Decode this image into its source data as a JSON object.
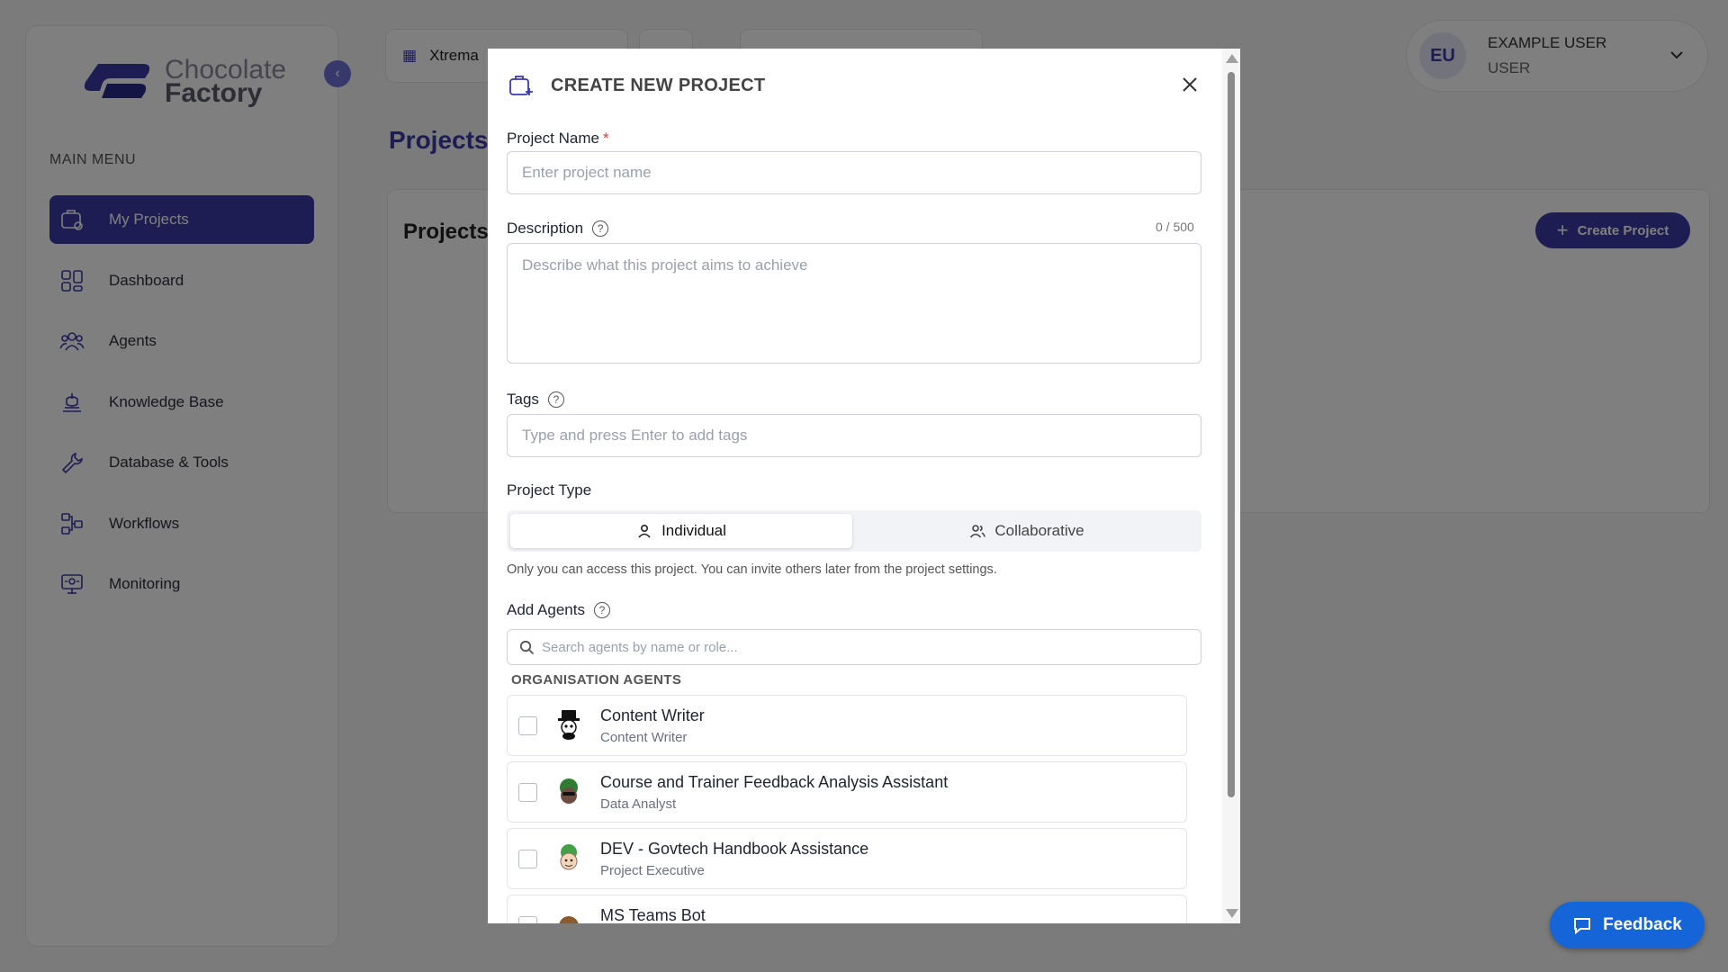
{
  "brand": {
    "line1": "Chocolate",
    "line2": "Factory"
  },
  "sidebar": {
    "heading": "MAIN MENU",
    "items": [
      {
        "label": "My Projects",
        "icon": "projects-icon",
        "active": true
      },
      {
        "label": "Dashboard",
        "icon": "dashboard-icon",
        "active": false
      },
      {
        "label": "Agents",
        "icon": "agents-icon",
        "active": false
      },
      {
        "label": "Knowledge Base",
        "icon": "knowledge-base-icon",
        "active": false
      },
      {
        "label": "Database & Tools",
        "icon": "tools-icon",
        "active": false
      },
      {
        "label": "Workflows",
        "icon": "workflows-icon",
        "active": false
      },
      {
        "label": "Monitoring",
        "icon": "monitoring-icon",
        "active": false
      }
    ]
  },
  "topbar": {
    "org_label": "Xtrema",
    "user": {
      "initials": "EU",
      "name": "EXAMPLE USER",
      "role": "USER"
    }
  },
  "page": {
    "title": "Projects",
    "content_title": "Projects",
    "create_label": "Create Project"
  },
  "modal": {
    "title": "CREATE NEW PROJECT",
    "project_name": {
      "label": "Project Name",
      "required_mark": "*",
      "placeholder": "Enter project name",
      "value": ""
    },
    "description": {
      "label": "Description",
      "counter": "0 / 500",
      "placeholder": "Describe what this project aims to achieve",
      "value": ""
    },
    "tags": {
      "label": "Tags",
      "placeholder": "Type and press Enter to add tags",
      "value": ""
    },
    "project_type": {
      "label": "Project Type",
      "options": [
        "Individual",
        "Collaborative"
      ],
      "selected": "Individual",
      "hint": "Only you can access this project. You can invite others later from the project settings."
    },
    "add_agents": {
      "label": "Add Agents",
      "search_placeholder": "Search agents by name or role...",
      "section_label": "ORGANISATION AGENTS",
      "agents": [
        {
          "name": "Content Writer",
          "role": "Content Writer",
          "checked": false
        },
        {
          "name": "Course and Trainer Feedback Analysis Assistant",
          "role": "Data Analyst",
          "checked": false
        },
        {
          "name": "DEV - Govtech Handbook Assistance",
          "role": "Project Executive",
          "checked": false
        },
        {
          "name": "MS Teams Bot",
          "role": "",
          "checked": false
        }
      ]
    }
  },
  "feedback": {
    "label": "Feedback"
  },
  "colors": {
    "primary": "#3b3aa8",
    "feedback": "#1565d8",
    "required": "#e53935"
  }
}
